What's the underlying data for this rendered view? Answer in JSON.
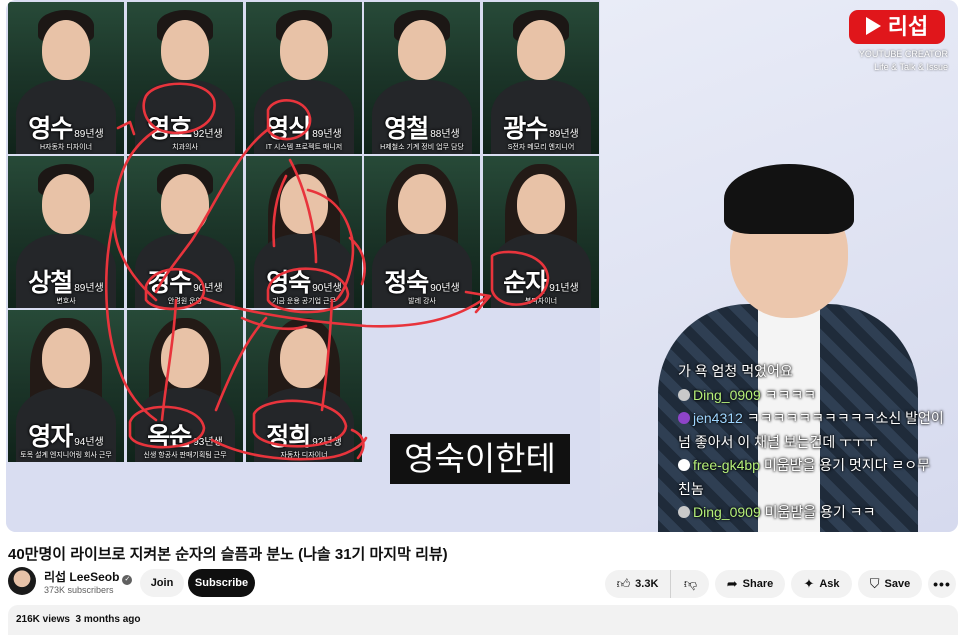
{
  "video": {
    "caption": "영숙이한테",
    "cast": [
      {
        "name": "영수",
        "year": "89년생",
        "job": "H자동차 디자이너",
        "gender": "m"
      },
      {
        "name": "영호",
        "year": "92년생",
        "job": "치과의사",
        "gender": "m"
      },
      {
        "name": "영식",
        "year": "89년생",
        "job": "IT 시스템 프로젝트 매니저",
        "gender": "m"
      },
      {
        "name": "영철",
        "year": "88년생",
        "job": "H제철소 기계 정비 업무 담당",
        "gender": "m"
      },
      {
        "name": "광수",
        "year": "89년생",
        "job": "S전자 메모리 엔지니어",
        "gender": "m"
      },
      {
        "name": "상철",
        "year": "89년생",
        "job": "변호사",
        "gender": "m"
      },
      {
        "name": "경수",
        "year": "90년생",
        "job": "안경원 운영",
        "gender": "m"
      },
      {
        "name": "영숙",
        "year": "90년생",
        "job": "기금 운용 공기업 근무",
        "gender": "f"
      },
      {
        "name": "정숙",
        "year": "90년생",
        "job": "발레 강사",
        "gender": "f"
      },
      {
        "name": "순자",
        "year": "91년생",
        "job": "북디자이너",
        "gender": "f"
      },
      {
        "name": "영자",
        "year": "94년생",
        "job": "토목 설계 엔지니어링 회사 근무",
        "gender": "f"
      },
      {
        "name": "옥순",
        "year": "93년생",
        "job": "신생 항공사 판매기획팀 근무",
        "gender": "f"
      },
      {
        "name": "정희",
        "year": "92년생",
        "job": "자동차 디자이너",
        "gender": "f"
      }
    ],
    "brand": {
      "label": "리섭",
      "creator_line1": "YOUTUBE CREATOR",
      "creator_line2": "Life & Talk & Issue"
    },
    "chat": [
      {
        "author": "",
        "text": "가 욕 엄청 먹었어요",
        "avatar": "none"
      },
      {
        "author": "Ding_0909",
        "text": "ㅋㅋㅋㅋ",
        "avatar": "gray"
      },
      {
        "author": "jen4312",
        "text": "ㅋㅋㅋㅋㅋㅋㅋㅋㅋㅋ소신 발언이",
        "avatar": "purple"
      },
      {
        "author": "",
        "text": "넘 좋아서 이 채널 보는건데 ㅜㅜㅜ",
        "avatar": "none"
      },
      {
        "author": "free-gk4bp",
        "text": "미움받을 용기 멋지다 ㄹㅇ무",
        "avatar": "white"
      },
      {
        "author": "",
        "text": "친놈",
        "avatar": "none"
      },
      {
        "author": "Ding_0909",
        "text": "미움받을 용기 ㅋㅋ",
        "avatar": "gray"
      }
    ]
  },
  "meta": {
    "title": "40만명이 라이브로 지켜본 순자의 슬픔과 분노 (나솔 31기 마지막 리뷰)",
    "channel_name": "리섭 LeeSeob",
    "subscribers": "373K subscribers",
    "join_label": "Join",
    "subscribe_label": "Subscribe",
    "like_count": "3.3K",
    "share_label": "Share",
    "ask_label": "Ask",
    "save_label": "Save",
    "views": "216K views",
    "age": "3 months ago"
  },
  "icons": {
    "verified": "verified-check-icon",
    "like": "thumbs-up-icon",
    "dislike": "thumbs-down-icon",
    "share": "share-arrow-icon",
    "ask": "sparkle-icon",
    "save": "bookmark-icon",
    "more": "more-horizontal-icon"
  },
  "colors": {
    "brand_red": "#e0161b",
    "subscribe_bg": "#0f0f0f",
    "pill_bg": "#f2f2f2",
    "chat_author": "#b6f07a",
    "annotation_red": "#e8343c"
  }
}
